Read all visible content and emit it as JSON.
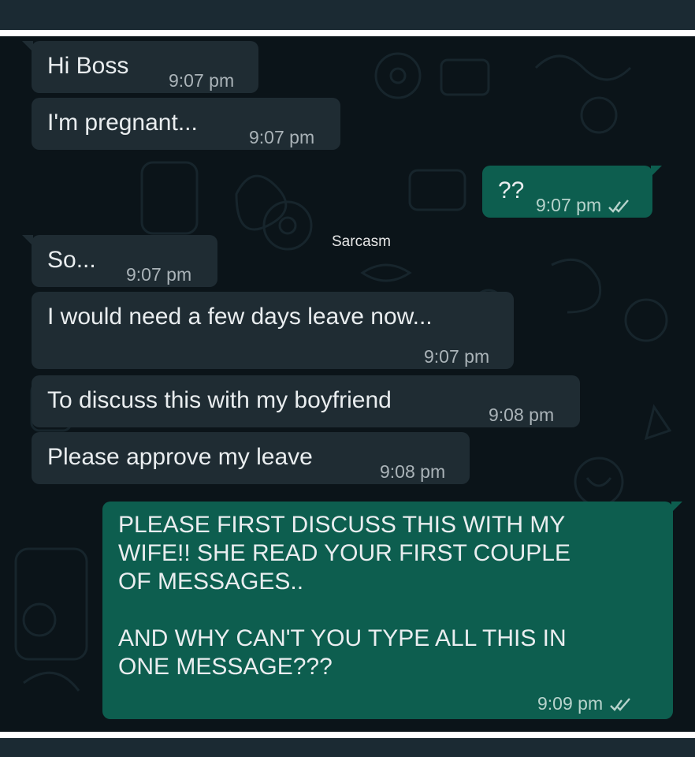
{
  "watermark": "Sarcasm",
  "colors": {
    "chat_background": "#0b1419",
    "incoming_bubble": "#1f2c33",
    "outgoing_bubble": "#0d5e4f",
    "text": "#e9edef",
    "frame": "#1b2a33"
  },
  "messages": [
    {
      "direction": "incoming",
      "text": "Hi Boss",
      "time": "9:07 pm"
    },
    {
      "direction": "incoming",
      "text": "I'm pregnant...",
      "time": "9:07 pm"
    },
    {
      "direction": "outgoing",
      "text": "??",
      "time": "9:07 pm",
      "status_icon": "double-check-icon"
    },
    {
      "direction": "incoming",
      "text": "So...",
      "time": "9:07 pm"
    },
    {
      "direction": "incoming",
      "text": "I would need a few days leave now...",
      "time": "9:07 pm"
    },
    {
      "direction": "incoming",
      "text": "To discuss this with my boyfriend",
      "time": "9:08 pm"
    },
    {
      "direction": "incoming",
      "text": "Please approve my leave",
      "time": "9:08 pm"
    },
    {
      "direction": "outgoing",
      "text": "PLEASE FIRST DISCUSS THIS WITH MY\nWIFE!! SHE READ YOUR FIRST COUPLE\nOF MESSAGES..\n\nAND WHY CAN'T YOU TYPE ALL THIS IN\nONE MESSAGE???",
      "time": "9:09 pm",
      "status_icon": "double-check-icon"
    }
  ]
}
